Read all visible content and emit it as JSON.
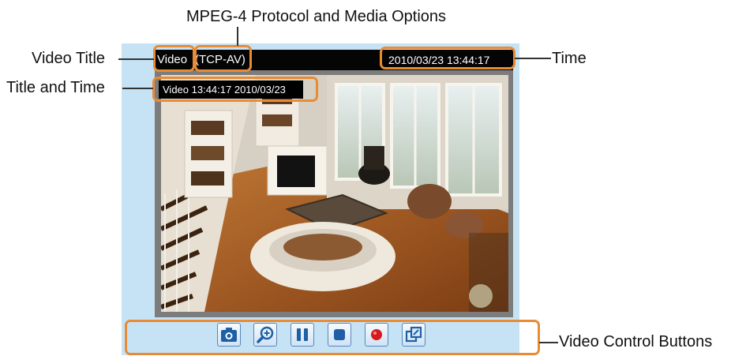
{
  "callouts": {
    "protocol": "MPEG-4 Protocol and Media Options",
    "video_title": "Video Title",
    "title_time": "Title and Time",
    "time": "Time",
    "controls": "Video Control Buttons"
  },
  "titlebar": {
    "title": "Video",
    "protocol": "(TCP-AV)",
    "timestamp": "2010/03/23 13:44:17"
  },
  "overlay": {
    "text": "Video 13:44:17  2010/03/23"
  },
  "controls": [
    {
      "name": "snapshot-button",
      "icon": "camera-icon"
    },
    {
      "name": "digital-zoom-button",
      "icon": "zoom-in-icon"
    },
    {
      "name": "pause-button",
      "icon": "pause-icon"
    },
    {
      "name": "stop-button",
      "icon": "stop-icon"
    },
    {
      "name": "record-button",
      "icon": "record-icon"
    },
    {
      "name": "fullscreen-button",
      "icon": "fullscreen-icon"
    }
  ],
  "colors": {
    "annotation": "#e98b35",
    "viewer_background": "#c6e3f5",
    "title_bar": "#050505"
  }
}
